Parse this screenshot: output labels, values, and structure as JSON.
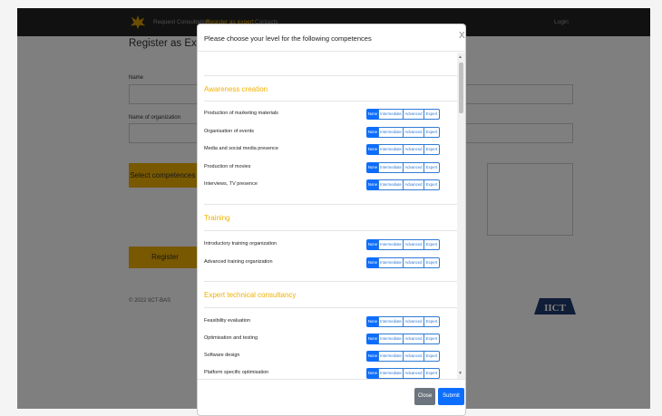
{
  "navbar": {
    "links": [
      "Request Consultation",
      "Register as expert",
      "Contacts"
    ],
    "login": "Login"
  },
  "page": {
    "title": "Register as Expert",
    "name_label": "Name",
    "org_label": "Name of organization",
    "select_competences": "Select competences *",
    "register": "Register",
    "footer": "© 2022 IICT-BAS",
    "logo_text": "IICT"
  },
  "modal": {
    "title": "Please choose your level for the following competences",
    "close_glyph": "X",
    "levels": [
      "None",
      "Intermediate",
      "Advanced",
      "Expert"
    ],
    "selected_level": "None",
    "sections": [
      {
        "title": "Awareness creation",
        "items": [
          "Production of marketing materials",
          "Organisation of events",
          "Media and social media presence",
          "Production of movies",
          "Interviews, TV presence"
        ]
      },
      {
        "title": "Training",
        "items": [
          "Introductory training organization",
          "Advanced training organization"
        ]
      },
      {
        "title": "Expert technical consultancy",
        "items": [
          "Feasibility evaluation",
          "Optimisation and testing",
          "Software design",
          "Platform specific optimisation"
        ]
      }
    ],
    "close_label": "Close",
    "submit_label": "Submit"
  },
  "colors": {
    "accent": "#f0b100",
    "primary": "#0d6efd",
    "navbar": "#222222"
  }
}
